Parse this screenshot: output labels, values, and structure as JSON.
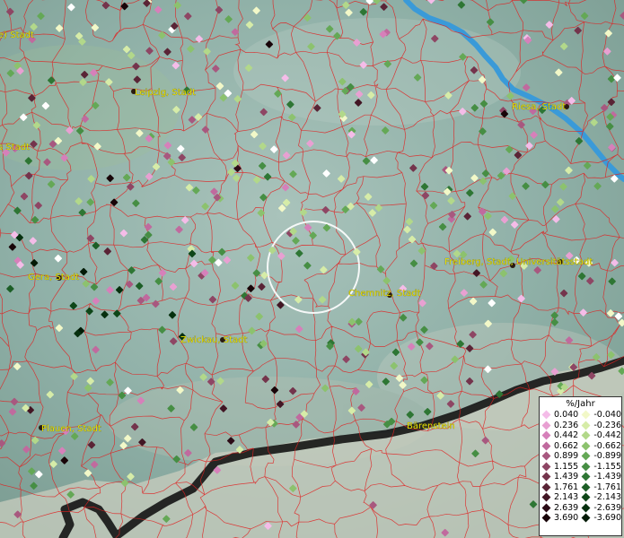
{
  "map": {
    "cities": [
      {
        "name": "Leipzig, Stadt"
      },
      {
        "name": "Riesa, Stadt"
      },
      {
        "name": "Gera, Stadt"
      },
      {
        "name": "Freiberg, Stadt, Universitätsstadt"
      },
      {
        "name": "Chemnitz, Stadt"
      },
      {
        "name": "Zwickau, Stadt"
      },
      {
        "name": "Plauen, Stadt"
      },
      {
        "name": "Bärenstein"
      },
      {
        "name": "e) Stadt"
      },
      {
        "name": "s Stadt"
      }
    ]
  },
  "legend": {
    "title": "%/Jahr",
    "positive": [
      {
        "label": "0.040",
        "color": "#f4bce8"
      },
      {
        "label": "0.236",
        "color": "#e8a0d2"
      },
      {
        "label": "0.442",
        "color": "#d680ba"
      },
      {
        "label": "0.662",
        "color": "#c06a9e"
      },
      {
        "label": "0.899",
        "color": "#a8587f"
      },
      {
        "label": "1.155",
        "color": "#8e4664"
      },
      {
        "label": "1.439",
        "color": "#74344c"
      },
      {
        "label": "1.761",
        "color": "#5a2436"
      },
      {
        "label": "2.143",
        "color": "#421624"
      },
      {
        "label": "2.639",
        "color": "#2c0c16"
      },
      {
        "label": "3.690",
        "color": "#180408"
      }
    ],
    "negative": [
      {
        "label": "-0.040",
        "color": "#f2f8c8"
      },
      {
        "label": "-0.236",
        "color": "#d6eca8"
      },
      {
        "label": "-0.442",
        "color": "#b2d88a"
      },
      {
        "label": "-0.662",
        "color": "#8cc26e"
      },
      {
        "label": "-0.899",
        "color": "#64a856"
      },
      {
        "label": "-1.155",
        "color": "#468e44"
      },
      {
        "label": "-1.439",
        "color": "#2e7634"
      },
      {
        "label": "-1.761",
        "color": "#1c5e26"
      },
      {
        "label": "-2.143",
        "color": "#0e4618"
      },
      {
        "label": "-2.639",
        "color": "#06300e"
      },
      {
        "label": "-3.690",
        "color": "#021a06"
      }
    ]
  },
  "colors": {
    "terrain": "#8cb0a8",
    "river": "#3a9ad8",
    "boundary": "#e02020",
    "border": "#141414",
    "city_label": "#e8e000"
  }
}
